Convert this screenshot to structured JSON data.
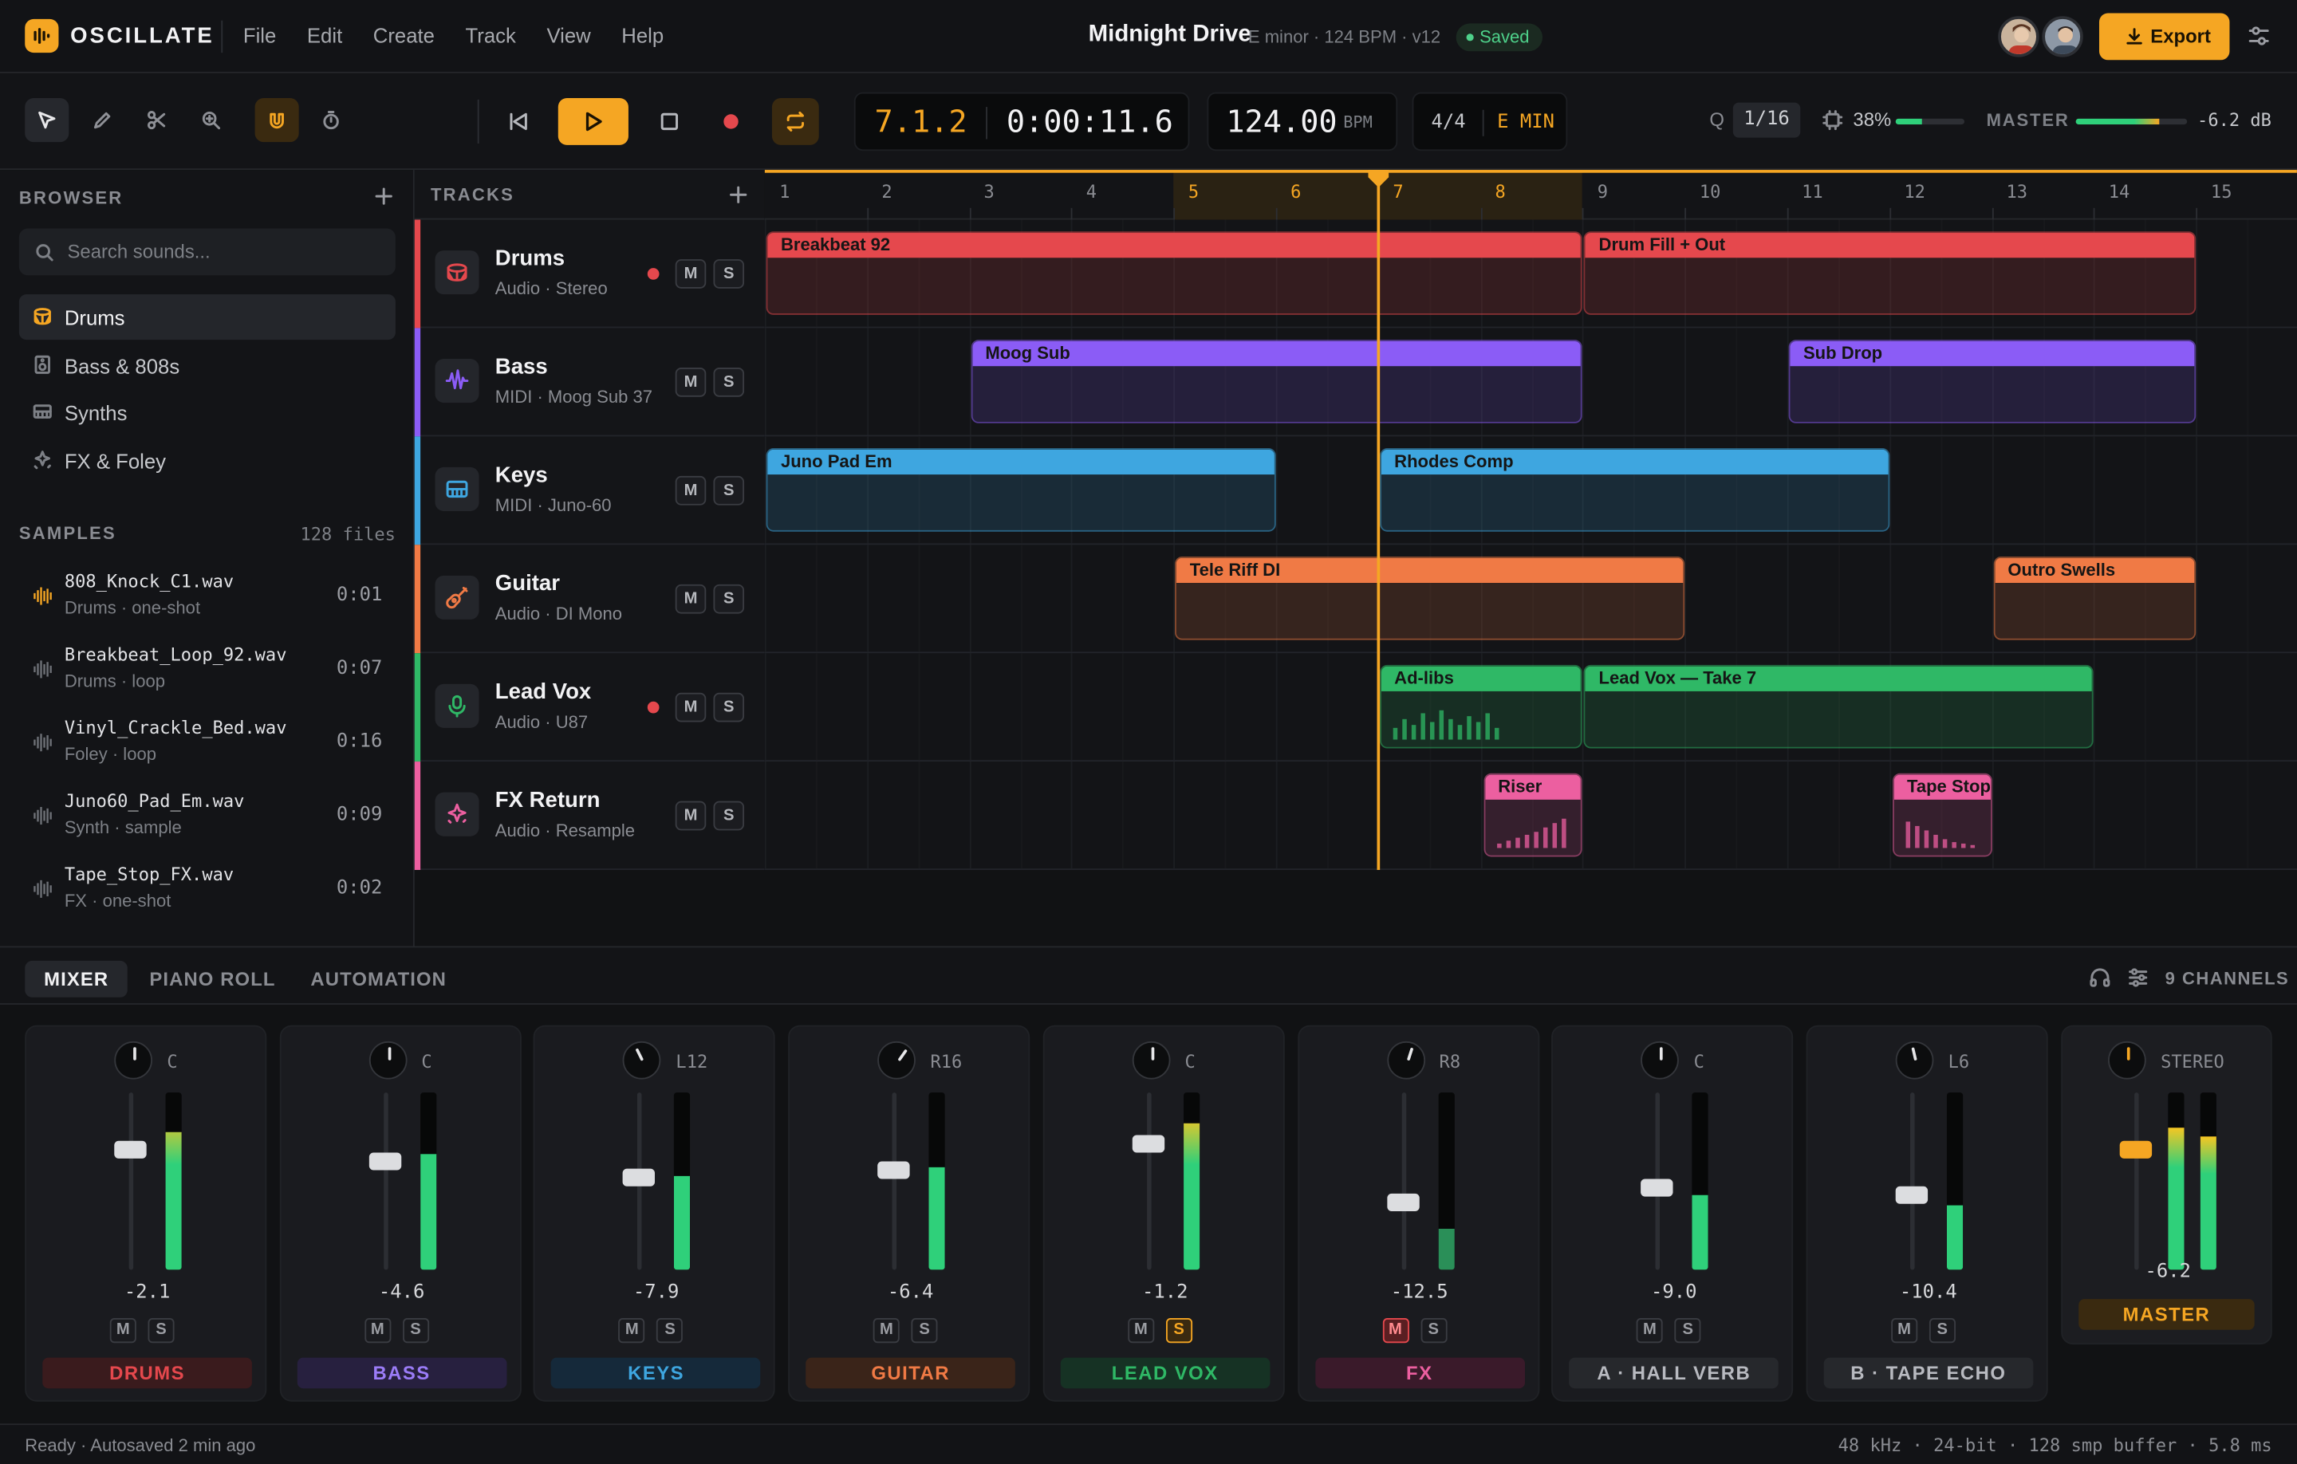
{
  "app": {
    "name": "OSCILLATE",
    "menu": [
      "File",
      "Edit",
      "Create",
      "Track",
      "View",
      "Help"
    ]
  },
  "project": {
    "title": "Midnight Drive",
    "meta": "E minor · 124 BPM · v12",
    "status": "Saved"
  },
  "export_label": "Export",
  "transport": {
    "position": "7.1.2",
    "time": "0:00:11.6",
    "tempo": "124.00",
    "tempo_unit": "BPM",
    "signature": "4/4",
    "key": "E MIN",
    "quantize_label": "Q",
    "quantize": "1/16",
    "cpu": "38%",
    "cpu_level": 0.38,
    "master_label": "MASTER",
    "master_db": "-6.2 dB",
    "master_level": 0.75
  },
  "browser": {
    "title": "BROWSER",
    "search_placeholder": "Search sounds...",
    "categories": [
      "Drums",
      "Bass & 808s",
      "Synths",
      "FX & Foley"
    ],
    "samples_title": "SAMPLES",
    "samples_count": "128 files",
    "samples": [
      {
        "name": "808_Knock_C1.wav",
        "tag": "Drums · one-shot",
        "dur": "0:01"
      },
      {
        "name": "Breakbeat_Loop_92.wav",
        "tag": "Drums · loop",
        "dur": "0:07"
      },
      {
        "name": "Vinyl_Crackle_Bed.wav",
        "tag": "Foley · loop",
        "dur": "0:16"
      },
      {
        "name": "Juno60_Pad_Em.wav",
        "tag": "Synth · sample",
        "dur": "0:09"
      },
      {
        "name": "Tape_Stop_FX.wav",
        "tag": "FX · one-shot",
        "dur": "0:02"
      }
    ]
  },
  "tracks": {
    "title": "TRACKS",
    "items": [
      {
        "name": "Drums",
        "type": "Audio · Stereo",
        "color": "#e5484d",
        "armed": true,
        "icon": "drum-icon"
      },
      {
        "name": "Bass",
        "type": "MIDI · Moog Sub 37",
        "color": "#8b5cf6",
        "armed": false,
        "icon": "waveform-icon"
      },
      {
        "name": "Keys",
        "type": "MIDI · Juno-60",
        "color": "#3ea6e0",
        "armed": false,
        "icon": "piano-icon"
      },
      {
        "name": "Guitar",
        "type": "Audio · DI Mono",
        "color": "#f07a45",
        "armed": false,
        "icon": "guitar-icon"
      },
      {
        "name": "Lead Vox",
        "type": "Audio · U87",
        "color": "#2fb866",
        "armed": true,
        "icon": "mic-icon"
      },
      {
        "name": "FX Return",
        "type": "Audio · Resample",
        "color": "#ec5fa0",
        "armed": false,
        "icon": "sparkle-icon"
      }
    ],
    "mute_label": "M",
    "solo_label": "S"
  },
  "ruler": {
    "bars": [
      "1",
      "2",
      "3",
      "4",
      "5",
      "6",
      "7",
      "8",
      "9",
      "10",
      "11",
      "12",
      "13",
      "14",
      "15"
    ],
    "loop": [
      5,
      9
    ],
    "playhead_bar": 7.0
  },
  "clips": [
    {
      "name": "Breakbeat 92",
      "lane": 0,
      "start": 1,
      "end": 9
    },
    {
      "name": "Drum Fill + Out",
      "lane": 0,
      "start": 9,
      "end": 15
    },
    {
      "name": "Moog Sub",
      "lane": 1,
      "start": 3,
      "end": 9
    },
    {
      "name": "Sub Drop",
      "lane": 1,
      "start": 11,
      "end": 15
    },
    {
      "name": "Juno Pad Em",
      "lane": 2,
      "start": 1,
      "end": 6
    },
    {
      "name": "Rhodes Comp",
      "lane": 2,
      "start": 7,
      "end": 12
    },
    {
      "name": "Tele Riff DI",
      "lane": 3,
      "start": 5,
      "end": 10
    },
    {
      "name": "Outro Swells",
      "lane": 3,
      "start": 13,
      "end": 15
    },
    {
      "name": "Ad-libs",
      "lane": 4,
      "start": 7,
      "end": 9
    },
    {
      "name": "Lead Vox — Take 7",
      "lane": 4,
      "start": 9,
      "end": 14
    },
    {
      "name": "Riser",
      "lane": 5,
      "start": 8,
      "end": 9
    },
    {
      "name": "Tape Stop",
      "lane": 5,
      "start": 12,
      "end": 13
    }
  ],
  "mixer": {
    "tabs": [
      "MIXER",
      "PIANO ROLL",
      "AUTOMATION"
    ],
    "channels_label": "9 CHANNELS",
    "strips": [
      {
        "label": "DRUMS",
        "pan": "C",
        "db": "-2.1",
        "fader": 0.68,
        "meter": 0.78,
        "color": "#e5484d",
        "bg": "#3a1b1d"
      },
      {
        "label": "BASS",
        "pan": "C",
        "db": "-4.6",
        "fader": 0.61,
        "meter": 0.65,
        "color": "#9b7cf7",
        "bg": "#27203f"
      },
      {
        "label": "KEYS",
        "pan": "L12",
        "db": "-7.9",
        "fader": 0.52,
        "meter": 0.53,
        "color": "#3ea6e0",
        "bg": "#15293a"
      },
      {
        "label": "GUITAR",
        "pan": "R16",
        "db": "-6.4",
        "fader": 0.56,
        "meter": 0.58,
        "color": "#f07a45",
        "bg": "#3a2419"
      },
      {
        "label": "LEAD VOX",
        "pan": "C",
        "db": "-1.2",
        "fader": 0.71,
        "meter": 0.83,
        "color": "#2fb866",
        "bg": "#163224"
      },
      {
        "label": "FX",
        "pan": "R8",
        "db": "-12.5",
        "fader": 0.38,
        "meter": 0.23,
        "color": "#ec5fa0",
        "bg": "#3a1a2a"
      },
      {
        "label": "A · HALL VERB",
        "pan": "C",
        "db": "-9.0",
        "fader": 0.46,
        "meter": 0.42,
        "color": "#b8bac0",
        "bg": "#26282c"
      },
      {
        "label": "B · TAPE ECHO",
        "pan": "L6",
        "db": "-10.4",
        "fader": 0.42,
        "meter": 0.36,
        "color": "#b8bac0",
        "bg": "#26282c"
      }
    ],
    "master": {
      "label": "MASTER",
      "pan": "STEREO",
      "db": "-6.2",
      "fader": 0.68,
      "meter_l": 0.8,
      "meter_r": 0.75,
      "color": "#f5a623",
      "bg": "#3a2a10"
    }
  },
  "statusbar": {
    "left": "Ready · Autosaved 2 min ago",
    "right": "48 kHz · 24-bit · 128 smp buffer · 5.8 ms"
  }
}
